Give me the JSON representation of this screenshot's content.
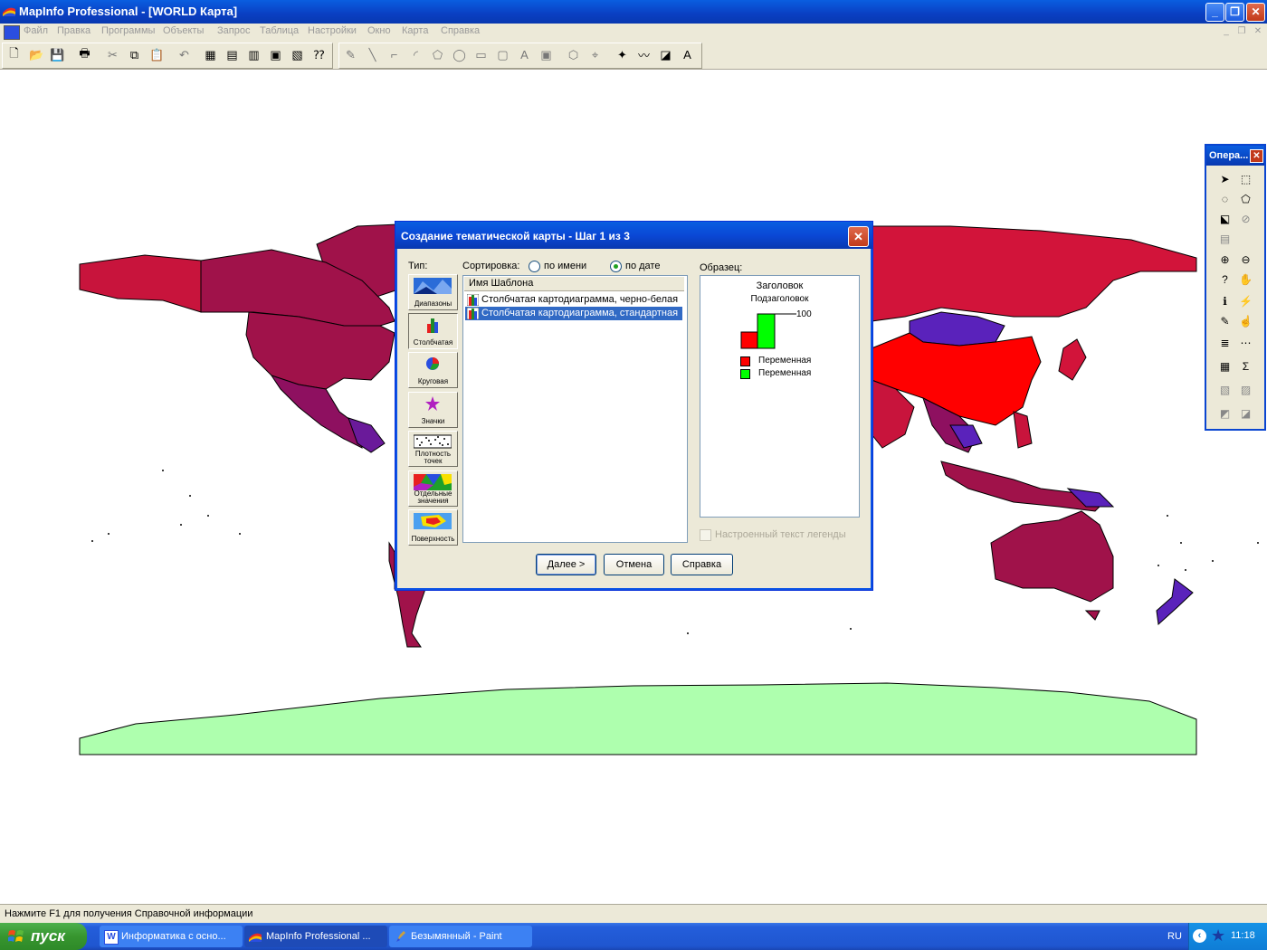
{
  "window": {
    "title": "MapInfo Professional - [WORLD Карта]",
    "minimize": "_",
    "restore": "❐",
    "close": "✕"
  },
  "menu": [
    "Файл",
    "Правка",
    "Программы",
    "Объекты",
    "Запрос",
    "Таблица",
    "Настройки",
    "Окно",
    "Карта",
    "Справка"
  ],
  "mdi_controls": [
    "_",
    "❐",
    "✕"
  ],
  "ops_palette": {
    "title": "Опера..."
  },
  "dialog": {
    "title": "Создание тематической карты - Шаг 1 из 3",
    "type_label": "Тип:",
    "types": [
      "Диапазоны",
      "Столбчатая",
      "Круговая",
      "Значки",
      "Плотность точек",
      "Отдельные значения",
      "Поверхность"
    ],
    "selected_type": "Столбчатая",
    "sort_label": "Сортировка:",
    "sort_options": [
      "по имени",
      "по дате"
    ],
    "sort_selected": "по дате",
    "list_header": "Имя Шаблона",
    "templates": [
      "Столбчатая картодиаграмма, черно-белая",
      "Столбчатая картодиаграмма, стандартная"
    ],
    "selected_template": "Столбчатая картодиаграмма, стандартная",
    "sample_label": "Образец:",
    "sample": {
      "title": "Заголовок",
      "subtitle": "Подзаголовок",
      "scale": "100",
      "legend": [
        "Переменная",
        "Переменная"
      ],
      "colors": [
        "#ff0000",
        "#00ff00"
      ]
    },
    "custom_legend_text": "Настроенный текст легенды",
    "buttons": {
      "next": "Далее >",
      "cancel": "Отмена",
      "help": "Справка"
    }
  },
  "status": {
    "text": "Нажмите F1 для получения Справочной информации"
  },
  "taskbar": {
    "start": "пуск",
    "tasks": [
      "Информатика с осно...",
      "MapInfo Professional ...",
      "Безымянный - Paint"
    ],
    "lang": "RU",
    "clock": "11:18"
  }
}
